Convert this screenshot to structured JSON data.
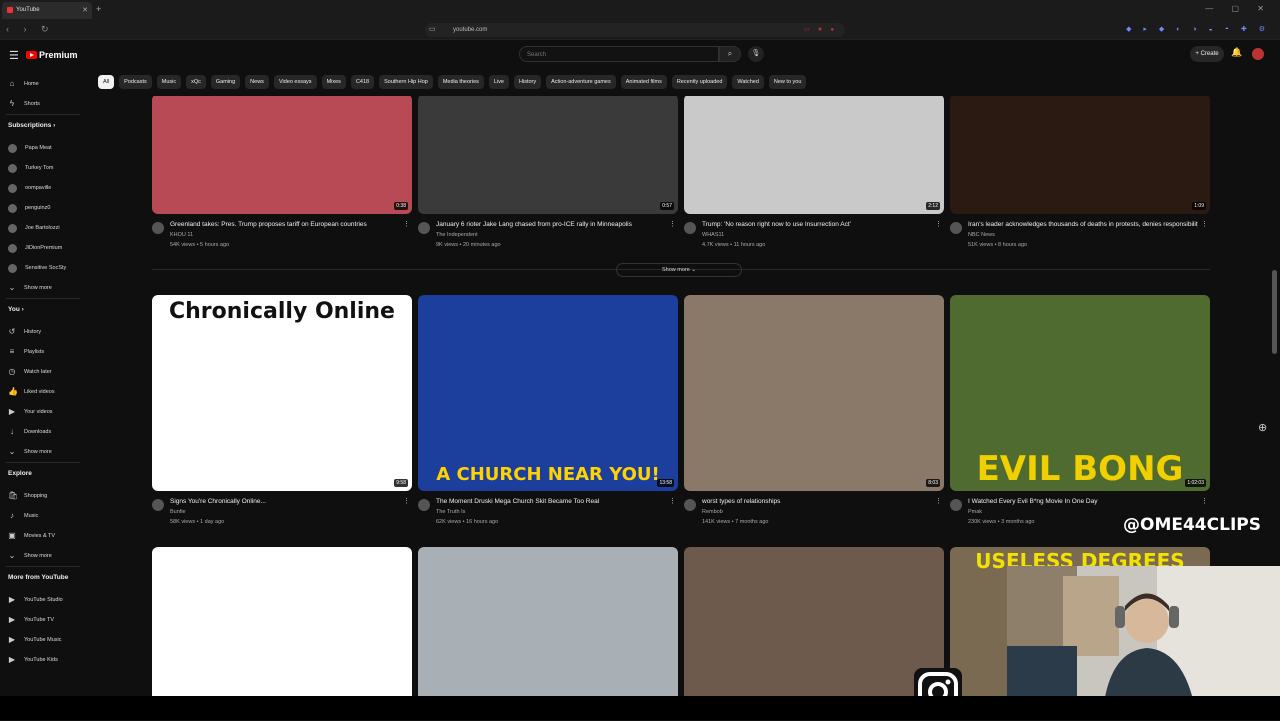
{
  "browser": {
    "tab_title": "YouTube",
    "url": "youtube.com",
    "new_tab_glyph": "+",
    "window_controls": "— ▢ ✕"
  },
  "masthead": {
    "logo_text": "Premium",
    "search_placeholder": "Search",
    "create_label": "+ Create",
    "menu_icon": "☰",
    "search_icon": "⌕",
    "mic_icon": "🎙",
    "bell_icon": "🔔"
  },
  "chips": [
    "All",
    "Podcasts",
    "Music",
    "xQc",
    "Gaming",
    "News",
    "Video essays",
    "Mixes",
    "C418",
    "Southern Hip Hop",
    "Media theories",
    "Live",
    "History",
    "Action-adventure games",
    "Animated films",
    "Recently uploaded",
    "Watched",
    "New to you"
  ],
  "sidebar": {
    "top": [
      {
        "label": "Home",
        "icon": "⌂"
      },
      {
        "label": "Shorts",
        "icon": "ϟ"
      }
    ],
    "subscriptions_header": "Subscriptions ›",
    "subscriptions": [
      "Papa Meat",
      "Turkey Tom",
      "oompaville",
      "penguinz0",
      "Joe Bartolozzi",
      "JiDionPremium",
      "Sensitive SocSty"
    ],
    "subs_show_more": "Show more",
    "you_header": "You ›",
    "you_items": [
      {
        "label": "History",
        "icon": "↺"
      },
      {
        "label": "Playlists",
        "icon": "≡"
      },
      {
        "label": "Watch later",
        "icon": "◷"
      },
      {
        "label": "Liked videos",
        "icon": "👍"
      },
      {
        "label": "Your videos",
        "icon": "▶"
      },
      {
        "label": "Downloads",
        "icon": "↓"
      }
    ],
    "you_show_more": "Show more",
    "explore_header": "Explore",
    "explore_items": [
      {
        "label": "Shopping",
        "icon": "🛍"
      },
      {
        "label": "Music",
        "icon": "♪"
      },
      {
        "label": "Movies & TV",
        "icon": "▣"
      }
    ],
    "explore_show_more": "Show more",
    "more_header": "More from YouTube",
    "more_items": [
      "YouTube Studio",
      "YouTube TV",
      "YouTube Music",
      "YouTube Kids"
    ]
  },
  "row1": [
    {
      "title": "Greenland takes: Pres. Trump proposes tariff on European countries",
      "channel": "KHOU 11",
      "meta": "54K views • 5 hours ago",
      "duration": "0:38",
      "thumb_color": "#b84a55"
    },
    {
      "title": "January 6 rioter Jake Lang chased from pro-ICE rally in Minneapolis",
      "channel": "The Independent",
      "meta": "9K views • 20 minutes ago",
      "duration": "0:57",
      "thumb_color": "#3a3a3a"
    },
    {
      "title": "Trump: 'No reason right now to use Insurrection Act'",
      "channel": "WHAS11",
      "meta": "4.7K views • 11 hours ago",
      "duration": "2:12",
      "thumb_color": "#c9c9c9"
    },
    {
      "title": "Iran's leader acknowledges thousands of deaths in protests, denies responsibility",
      "channel": "NBC News",
      "meta": "51K views • 8 hours ago",
      "duration": "1:09",
      "thumb_color": "#2a1a12"
    }
  ],
  "show_more": "Show more ⌄",
  "row2": [
    {
      "title": "Signs You're Chronically Online...",
      "channel": "Bunfie",
      "meta": "58K views • 1 day ago",
      "duration": "9:58",
      "thumb_color": "#ffffff",
      "thumb_text": "Chronically Online"
    },
    {
      "title": "The Moment Druski Mega Church Skit Became Too Real",
      "channel": "The Truth Is",
      "meta": "62K views • 16 hours ago",
      "duration": "13:58",
      "thumb_color": "#1c3f9e",
      "thumb_text": "A CHURCH NEAR YOU!"
    },
    {
      "title": "worst types of relationships",
      "channel": "Rembob",
      "meta": "141K views • 7 months ago",
      "duration": "8:03",
      "thumb_color": "#8a7868"
    },
    {
      "title": "I Watched Every Evil B*ng Movie In One Day",
      "channel": "Pmak",
      "meta": "230K views • 3 months ago",
      "duration": "1:02:03",
      "thumb_color": "#4f6b2f",
      "thumb_text": "EVIL BONG"
    }
  ],
  "row3": [
    {
      "thumb_color": "#ffffff"
    },
    {
      "thumb_color": "#a8b0b6"
    },
    {
      "thumb_color": "#6d5a4c"
    },
    {
      "thumb_color": "#7b6a52",
      "thumb_text": "USELESS DEGREES"
    }
  ],
  "overlay": {
    "handle": "@OME44CLIPS"
  }
}
